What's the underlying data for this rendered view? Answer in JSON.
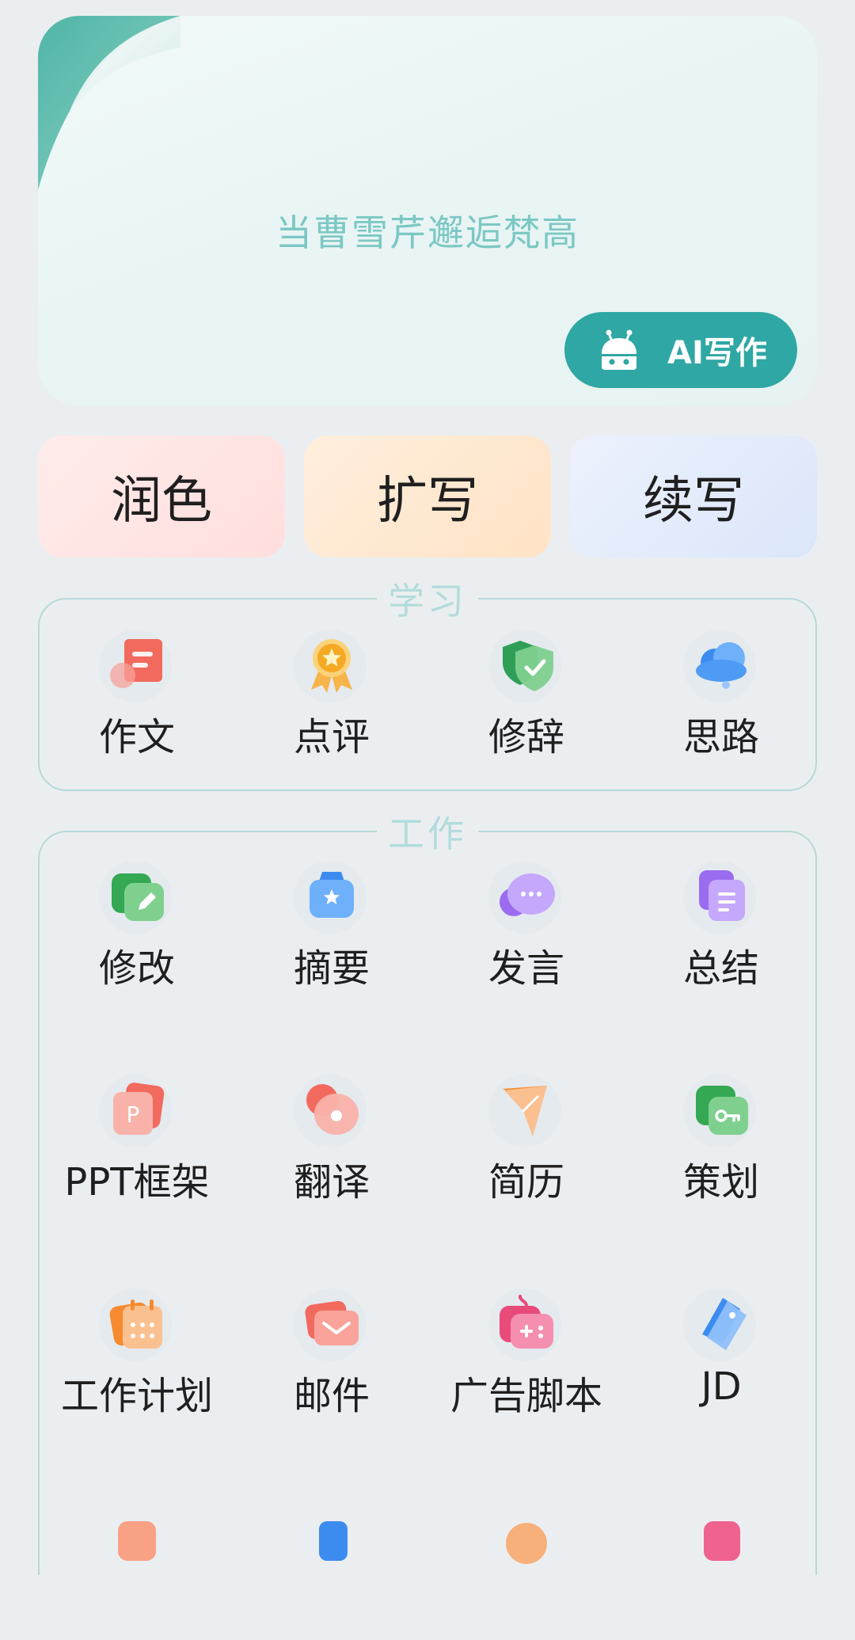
{
  "hero": {
    "text": "当曹雪芹邂逅梵高",
    "ai_button_label": "AI写作",
    "ai_icon": "robot-icon"
  },
  "actions": [
    {
      "label": "润色",
      "color": "#ffe2e1"
    },
    {
      "label": "扩写",
      "color": "#ffe8cf"
    },
    {
      "label": "续写",
      "color": "#e0e9fb"
    }
  ],
  "study": {
    "title": "学习",
    "items": [
      {
        "label": "作文",
        "icon": "essay-icon"
      },
      {
        "label": "点评",
        "icon": "award-medal-icon"
      },
      {
        "label": "修辞",
        "icon": "shield-check-icon"
      },
      {
        "label": "思路",
        "icon": "cloud-icon"
      }
    ]
  },
  "work": {
    "title": "工作",
    "items": [
      {
        "label": "修改",
        "icon": "edit-pencil-icon"
      },
      {
        "label": "摘要",
        "icon": "star-ticket-icon"
      },
      {
        "label": "发言",
        "icon": "chat-bubble-icon"
      },
      {
        "label": "总结",
        "icon": "document-stack-icon"
      },
      {
        "label": "PPT框架",
        "icon": "ppt-icon"
      },
      {
        "label": "翻译",
        "icon": "translate-icon"
      },
      {
        "label": "简历",
        "icon": "paper-plane-icon"
      },
      {
        "label": "策划",
        "icon": "key-card-icon"
      },
      {
        "label": "工作计划",
        "icon": "calendar-icon"
      },
      {
        "label": "邮件",
        "icon": "mail-icon"
      },
      {
        "label": "广告脚本",
        "icon": "gamepad-icon"
      },
      {
        "label": "JD",
        "icon": "tag-icon"
      }
    ]
  },
  "colors": {
    "accent": "#2fa7a4",
    "section_border": "#b5d9da",
    "section_title": "#b3dcdc",
    "hero_text": "#7cc8c4",
    "background": "#ebeef0"
  }
}
